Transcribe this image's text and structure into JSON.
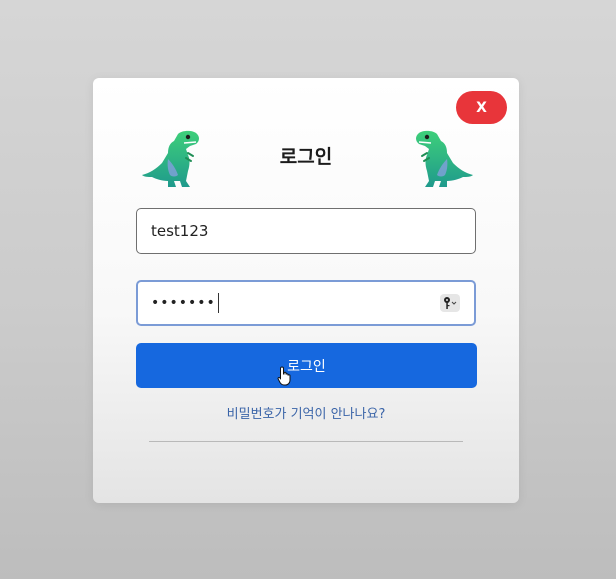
{
  "modal": {
    "close_label": "X",
    "title": "로그인",
    "decor_icon": "dinosaur-icon",
    "username": {
      "value": "test123"
    },
    "password": {
      "masked_value": "•••••••",
      "key_icon": "key-icon"
    },
    "submit_label": "로그인",
    "forgot_label": "비밀번호가 기억이 안나나요?"
  },
  "colors": {
    "close_button": "#e8353a",
    "primary_button": "#1668df",
    "link": "#3a64a8",
    "focus_border": "#7b9bd6"
  }
}
